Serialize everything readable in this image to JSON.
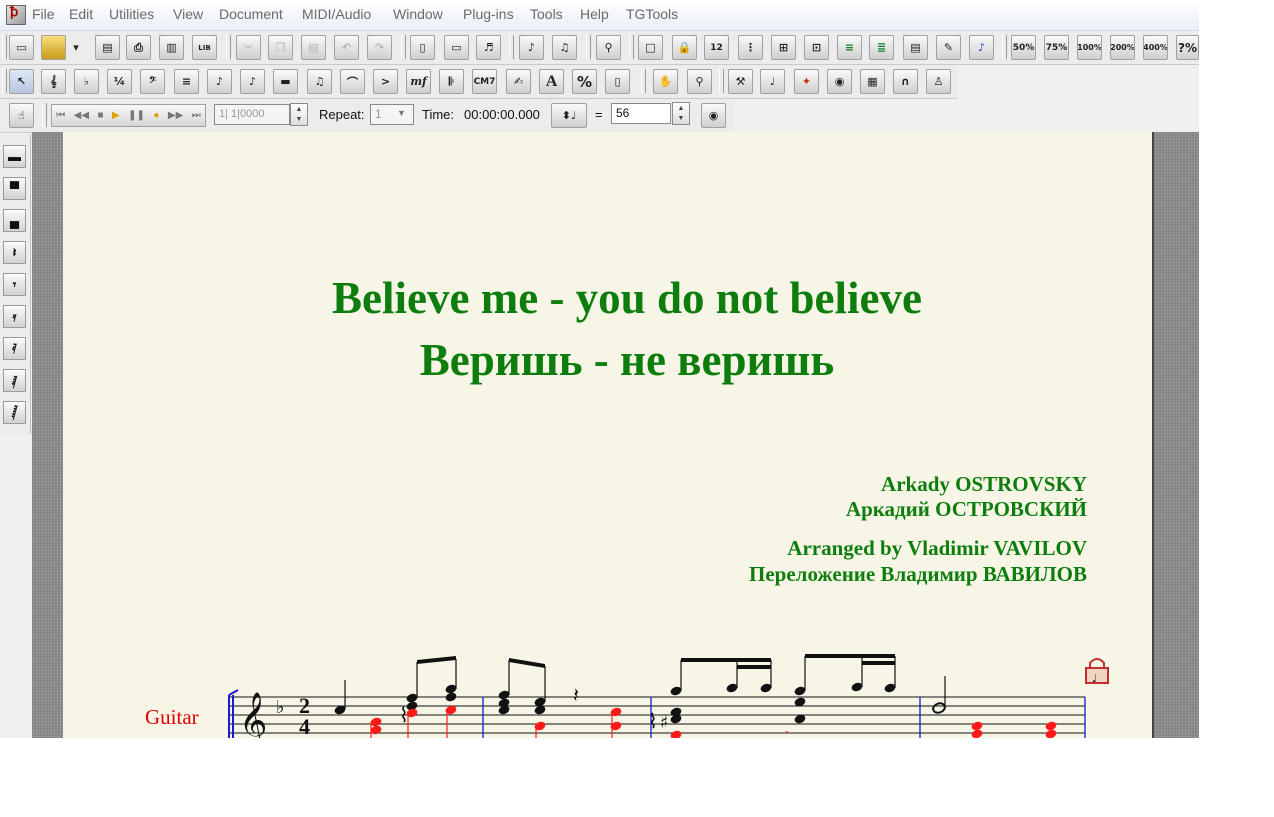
{
  "menu": {
    "app_icon": "finale-app-icon",
    "items": [
      "File",
      "Edit",
      "Utilities",
      "View",
      "Document",
      "MIDI/Audio",
      "Window",
      "Plug-ins",
      "Tools",
      "Help",
      "TGTools"
    ]
  },
  "toolbar": {
    "zoom_50": "50%",
    "zoom_75": "75%",
    "zoom_100": "100%",
    "zoom_200": "200%",
    "zoom_400": "400%",
    "zoom_custom": "?%",
    "text_tool": "A",
    "percent_tool": "%",
    "chord_tool": "CM7",
    "expression_tool": "mf"
  },
  "playback": {
    "measure": "1| 1|0000",
    "repeat_label": "Repeat:",
    "repeat_value": "1",
    "time_label": "Time:",
    "time_value": "00:00:00.000",
    "equals": "=",
    "tempo": "56"
  },
  "score": {
    "title_en": "Believe me - you do not believe",
    "title_ru": "Веришь - не веришь",
    "composer_en": "Arkady OSTROVSKY",
    "composer_ru": "Аркадий ОСТРОВСКИЙ",
    "arranger_en": "Arranged by Vladimir VAVILOV",
    "arranger_ru": "Переложение Владимир ВАВИЛОВ",
    "instrument": "Guitar",
    "time_signature_top": "2",
    "time_signature_bottom": "4",
    "key_signature": "F major (1 flat)"
  },
  "colors": {
    "title_green": "#0d7d0d",
    "instrument_red": "#e00000",
    "note_red": "#ff1a1a",
    "barline_blue": "#1a1ad0",
    "page_paper": "#f7f5e6"
  }
}
